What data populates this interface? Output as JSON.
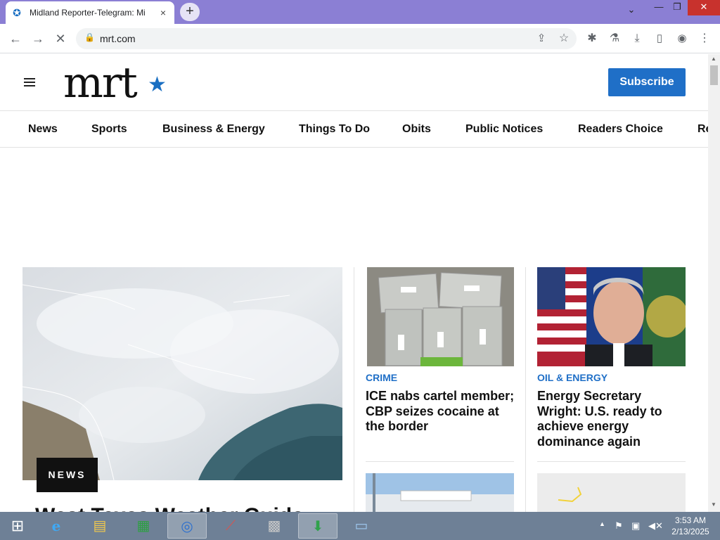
{
  "browser": {
    "tab_title": "Midland Reporter-Telegram: Mi",
    "tab_close": "×",
    "new_tab": "+",
    "url": "mrt.com",
    "controls": {
      "dropdown": "⌄",
      "minimize": "—",
      "restore": "❐",
      "close": "✕"
    }
  },
  "site": {
    "logo_text": "mrt",
    "logo_star": "★",
    "brand_color": "#1f6fc7",
    "subscribe_label": "Subscribe",
    "nav": [
      "News",
      "Sports",
      "Business & Energy",
      "Things To Do",
      "Obits",
      "Public Notices",
      "Readers Choice",
      "Re"
    ]
  },
  "stories": {
    "lead": {
      "tag": "NEWS",
      "headline_partial": "West Texas Weather Guide"
    },
    "story1": {
      "category": "CRIME",
      "headline": "ICE nabs cartel member; CBP seizes cocaine at the border"
    },
    "story2": {
      "category": "OIL & ENERGY",
      "headline": "Energy Secretary Wright: U.S. ready to achieve energy dominance again"
    }
  },
  "taskbar": {
    "time": "3:53 AM",
    "date": "2/13/2025",
    "icons": [
      "start-icon",
      "internet-explorer-icon",
      "file-explorer-icon",
      "store-icon",
      "chrome-icon",
      "app-icon",
      "firewall-icon",
      "download-manager-icon",
      "window-icon"
    ]
  }
}
